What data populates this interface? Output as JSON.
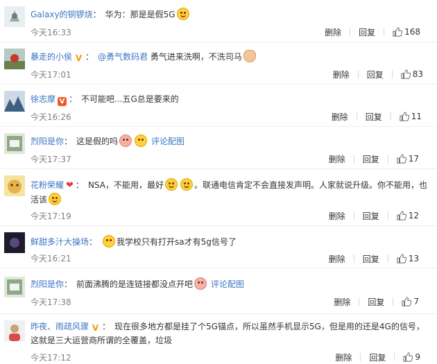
{
  "actions": {
    "delete": "删除",
    "reply": "回复"
  },
  "comments": [
    {
      "user": "Galaxy的铜锣烧",
      "badge": "",
      "text": "华为：那是是假5G",
      "time": "今天16:33",
      "likes": "168"
    },
    {
      "user": "暴走的小侯",
      "badge": "V",
      "mention": "@勇气数码君",
      "text": "勇气进来洗啊，不洗司马",
      "time": "今天17:01",
      "likes": "83"
    },
    {
      "user": "徐志摩",
      "badge": "VIP",
      "text": "不可能吧...五G总是要来的",
      "time": "今天16:26",
      "likes": "11"
    },
    {
      "user": "烈阳是你",
      "badge": "",
      "text": "这是假的吗",
      "link": "评论配图",
      "time": "今天17:37",
      "likes": "17"
    },
    {
      "user": "花粉荣耀",
      "badge": "heart",
      "text_a": "NSA，不能用，最好",
      "text_b": "。联通电信肯定不会直接发声明。人家就说升级。你不能用，也活该",
      "time": "今天17:19",
      "likes": "12"
    },
    {
      "user": "鲜甜多汁大操场",
      "badge": "",
      "text": "我学校只有打开sa才有5g信号了",
      "time": "今天16:21",
      "likes": "13"
    },
    {
      "user": "烈阳是你",
      "badge": "",
      "text": "前面沸腾的是连链接都没点开吧",
      "link": "评论配图",
      "time": "今天17:38",
      "likes": "7"
    },
    {
      "user": "昨夜、雨疏风骤",
      "badge": "V",
      "text": "现在很多地方都是挂了个5G锚点，所以虽然手机显示5G，但是用的还是4G的信号，这就是三大运营商所谓的全覆盖，垃圾",
      "time": "今天17:12",
      "likes": "9"
    }
  ]
}
